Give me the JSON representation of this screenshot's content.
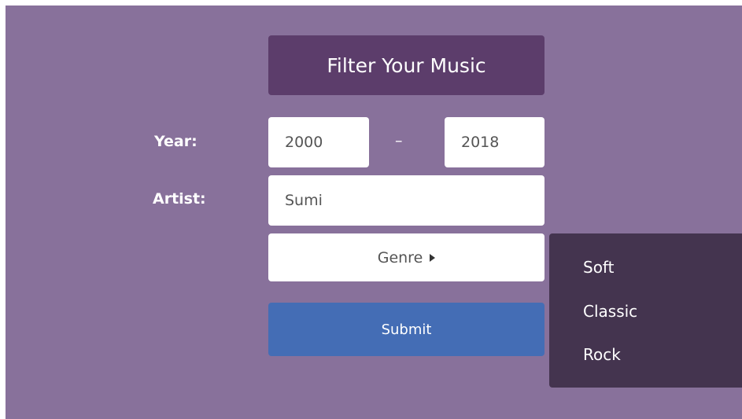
{
  "header": {
    "title": "Filter Your Music"
  },
  "form": {
    "year_label": "Year:",
    "year_from": "2000",
    "year_separator": "–",
    "year_to": "2018",
    "artist_label": "Artist:",
    "artist_value": "Sumi",
    "genre_label": "Genre",
    "submit_label": "Submit"
  },
  "genre_menu": {
    "items": [
      "Soft",
      "Classic",
      "Rock"
    ]
  },
  "colors": {
    "background": "#88719b",
    "title_box": "#5c3d6b",
    "submit_button": "#446db5",
    "menu": "#44344f"
  }
}
